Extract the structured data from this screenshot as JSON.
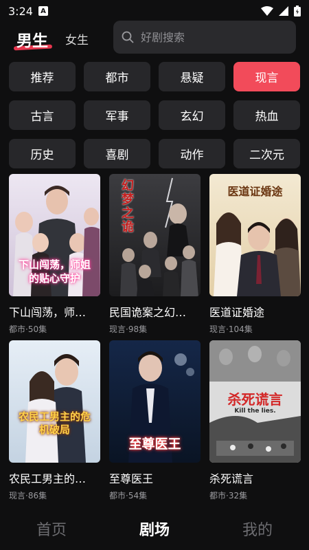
{
  "status": {
    "time": "3:24",
    "a_badge": "A"
  },
  "header": {
    "tab_male": "男生",
    "tab_female": "女生"
  },
  "search": {
    "placeholder": "好剧搜索"
  },
  "categories": [
    "推荐",
    "都市",
    "悬疑",
    "现言",
    "古言",
    "军事",
    "玄幻",
    "热血",
    "历史",
    "喜剧",
    "动作",
    "二次元"
  ],
  "active_category": "现言",
  "cards": [
    {
      "title": "下山闯荡，师…",
      "meta": "都市·50集",
      "poster_text": "下山闯荡，师姐的贴心守护",
      "accent": "#ff77b6"
    },
    {
      "title": "民国诡案之幻…",
      "meta": "现言·98集",
      "poster_text": "幻梦之诡",
      "accent": "#cc2a2a"
    },
    {
      "title": "医道证婚途",
      "meta": "现言·104集",
      "poster_text": "医道证婚途",
      "accent": "#7a3b14"
    },
    {
      "title": "农民工男主的…",
      "meta": "现言·86集",
      "poster_text": "农民工男主的危机破局",
      "accent": "#ffd24a"
    },
    {
      "title": "至尊医王",
      "meta": "都市·54集",
      "poster_text": "至尊医王",
      "accent": "#ff3a3a"
    },
    {
      "title": "杀死谎言",
      "meta": "都市·32集",
      "poster_text": "杀死谎言",
      "accent": "#d32626"
    }
  ],
  "poster_extra": {
    "kill_the_lies": "Kill the lies."
  },
  "bottom_nav": {
    "home": "首页",
    "theater": "剧场",
    "mine": "我的"
  },
  "colors": {
    "accent": "#f24b5a",
    "background": "#0f0f10",
    "chip": "#27272a"
  }
}
